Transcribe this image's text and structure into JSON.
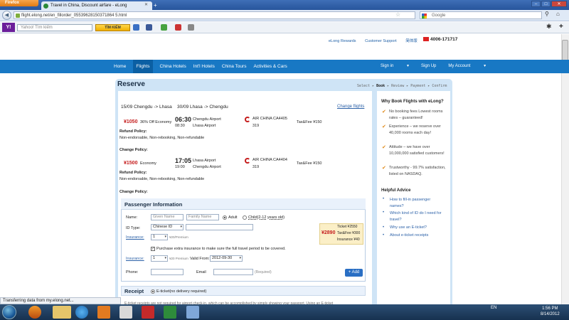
{
  "browser": {
    "app_button": "Firefox",
    "tab_title": "Travel in China, Discount airfare - eLong",
    "url": "flight.elong.net/en_fillorder_05539628150371864 5.html",
    "search_placeholder": "Google",
    "status": "Transferring data from my.elong.net..."
  },
  "yahoo_toolbar": {
    "logo": "Y!",
    "search_placeholder": "Yahoo! Tìm kiếm",
    "search_button": "TÌM KIẾM"
  },
  "header": {
    "links": [
      "eLong Rewards",
      "Customer Support",
      "简体版"
    ],
    "phone": "4006-171717"
  },
  "nav": {
    "items": [
      "Home",
      "Flights",
      "China Hotels",
      "Int'l Hotels",
      "China Tours",
      "Activities & Cars"
    ],
    "active": "Flights",
    "right": [
      "Sign in",
      "Sign Up",
      "My Account"
    ]
  },
  "reserve": {
    "title": "Reserve",
    "steps": [
      "Select",
      "Book",
      "Review",
      "Payment",
      "Confirm"
    ],
    "route_outbound": "15/09 Chengdu -> Lhasa",
    "route_return": "30/09 Lhasa -> Chengdu",
    "change_flights": "Change flights",
    "flights": [
      {
        "price": "¥1050",
        "discount": "36% Off Economy",
        "dep_time": "06:30",
        "arr_time": "08:30",
        "dep_airport": "Chengdu Airport",
        "arr_airport": "Lhasa Airport",
        "airline": "AIR CHINA CA4405",
        "aircraft": "319",
        "tax": "Tax&Fee ¥150",
        "refund_label": "Refund Policy:",
        "refund_text": "Non-endorsable, Non-rebooking, Non-refundable",
        "change_label": "Change Policy:"
      },
      {
        "price": "¥1500",
        "discount": "Economy",
        "dep_time": "17:05",
        "arr_time": "19:00",
        "dep_airport": "Lhasa Airport",
        "arr_airport": "Chengdu Airport",
        "airline": "AIR CHINA CA4404",
        "aircraft": "319",
        "tax": "Tax&Fee ¥150",
        "refund_label": "Refund Policy:",
        "refund_text": "Non-endorsable, Non-rebooking, Non-refundable",
        "change_label": "Change Policy:"
      }
    ]
  },
  "passenger": {
    "title": "Passenger Information",
    "name_label": "Name:",
    "given_placeholder": "Given Name",
    "family_placeholder": "Family Name",
    "adult": "Adult",
    "child": "Child(2-12 years old)",
    "id_label": "ID Type:",
    "id_value": "Chinese ID",
    "insurance_label": "Insurance:",
    "insurance_qty": "1",
    "insurance_note": "¥20/Premium",
    "insurance_checkbox": "Purchase extra insurance to make sure the full travel period to be covered.",
    "insurance2_note": "¥20 Premium",
    "valid_from_label": "Valid From:",
    "valid_from": "2012-09-30",
    "phone_label": "Phone:",
    "email_label": "Email",
    "required": "(Required)",
    "add_button": "+ Add",
    "total": "¥2890",
    "ticket": "Ticket ¥2550",
    "taxfee": "Tax&Fee ¥300",
    "insurance_fee": "Insurance ¥40"
  },
  "receipt": {
    "title": "Receipt",
    "option": "E-ticket(no delivery required)",
    "note": "E-ticket receipts are not required for airport check-in, which can be accomplished by simply showing your passport. Using an E-ticket"
  },
  "sidebar": {
    "why_title": "Why Book Flights with eLong?",
    "benefits": [
      "No booking fees   Lowest rooms rates – guaranteed!",
      "Experience – we reserve over 40,000 rooms each day!",
      "Attitude – we have over 10,000,000 satisfied customers!",
      "Trustworthy - 99.7% satisfaction, listed on NASDAQ."
    ],
    "help_title": "Helpful Advice",
    "help_links": [
      "How to fill-in passenger names?",
      "Which kind of ID do I need for travel?",
      "Why use an E-ticket?",
      "About e-ticket receipts"
    ]
  },
  "taskbar": {
    "lang": "EN",
    "time": "1:56 PM",
    "date": "8/14/2012"
  },
  "colors": {
    "nav_blue": "#1878c4",
    "panel": "#cfe4f6",
    "price_red": "#c51d1d",
    "link_blue": "#2d62a8"
  }
}
